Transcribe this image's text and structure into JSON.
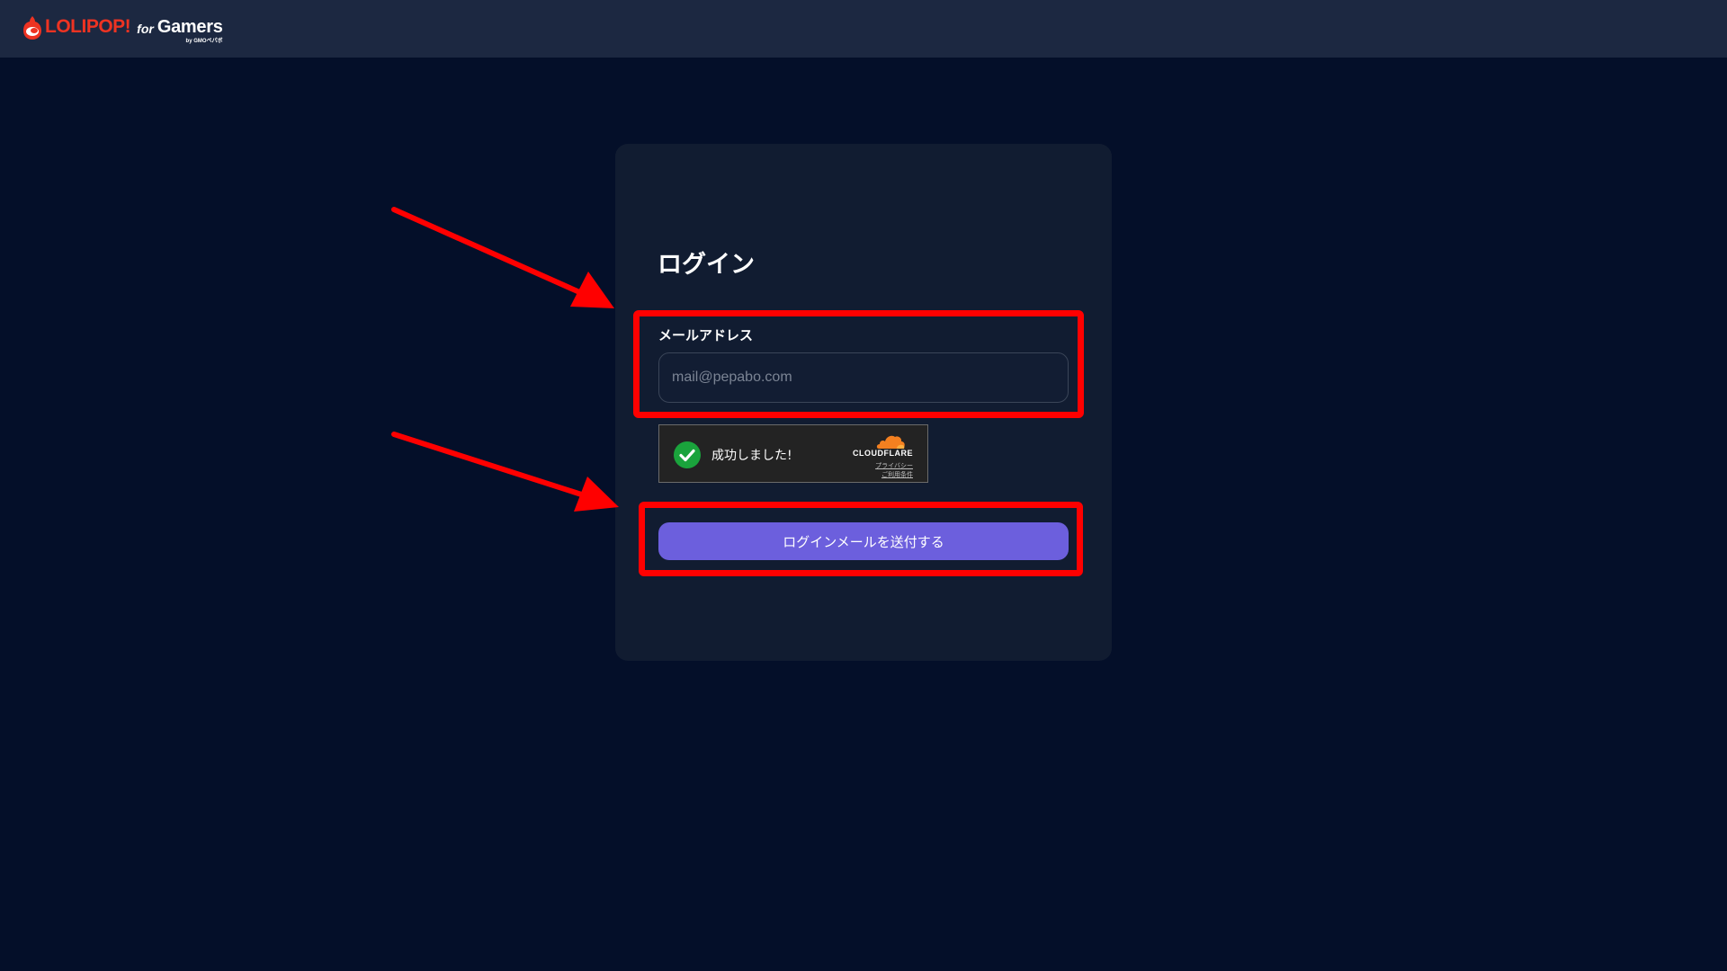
{
  "header": {
    "logo_brand": "LOLIPOP!",
    "logo_for": "for",
    "logo_gamers": "Gamers",
    "logo_by": "by GMOペパボ"
  },
  "login": {
    "title": "ログイン",
    "email_label": "メールアドレス",
    "email_placeholder": "mail@pepabo.com",
    "email_value": "",
    "submit_label": "ログインメールを送付する"
  },
  "captcha": {
    "status_text": "成功しました!",
    "brand": "CLOUDFLARE",
    "privacy_link": "プライバシー",
    "terms_link": "ご利用条件"
  },
  "colors": {
    "background": "#040f29",
    "header": "#1c2841",
    "card": "#111c31",
    "accent_button": "#6c5fdd",
    "brand_red": "#ee3322",
    "annotation_red": "#ff0000",
    "success_green": "#1aa33c",
    "cloudflare_orange": "#f38020"
  },
  "icons": {
    "logo": "lolipop-logo-icon",
    "captcha_status": "checkmark-circle-icon",
    "captcha_brand": "cloudflare-cloud-icon"
  }
}
